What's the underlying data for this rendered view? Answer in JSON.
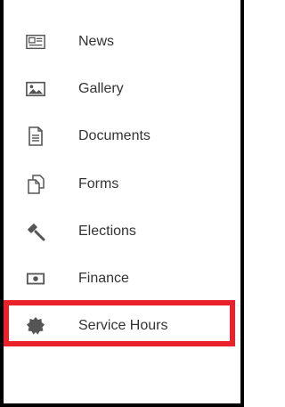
{
  "menu": {
    "items": [
      {
        "label": "News",
        "icon": "newspaper-icon"
      },
      {
        "label": "Gallery",
        "icon": "image-icon"
      },
      {
        "label": "Documents",
        "icon": "document-icon"
      },
      {
        "label": "Forms",
        "icon": "forms-icon"
      },
      {
        "label": "Elections",
        "icon": "gavel-icon"
      },
      {
        "label": "Finance",
        "icon": "money-icon"
      },
      {
        "label": "Service Hours",
        "icon": "badge-icon"
      }
    ],
    "highlighted_item": "Service Hours"
  },
  "colors": {
    "highlight_border": "#e8212b",
    "frame": "#000000",
    "icon": "#555555",
    "label": "#333333"
  }
}
